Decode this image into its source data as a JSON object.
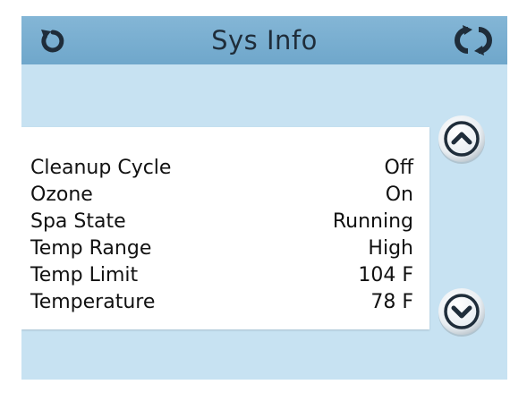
{
  "header": {
    "title": "Sys Info",
    "back_icon": "back-icon",
    "refresh_icon": "refresh-icon"
  },
  "info": {
    "rows": [
      {
        "label": "Cleanup Cycle",
        "value": "Off"
      },
      {
        "label": "Ozone",
        "value": "On"
      },
      {
        "label": "Spa State",
        "value": "Running"
      },
      {
        "label": "Temp Range",
        "value": "High"
      },
      {
        "label": "Temp Limit",
        "value": "104 F"
      },
      {
        "label": "Temperature",
        "value": "78 F"
      }
    ]
  },
  "nav": {
    "up_icon": "chevron-up-icon",
    "down_icon": "chevron-down-icon"
  },
  "colors": {
    "header": "#78aed0",
    "background": "#c7e2f2",
    "panel": "#ffffff",
    "icon": "#1f2d3a"
  }
}
